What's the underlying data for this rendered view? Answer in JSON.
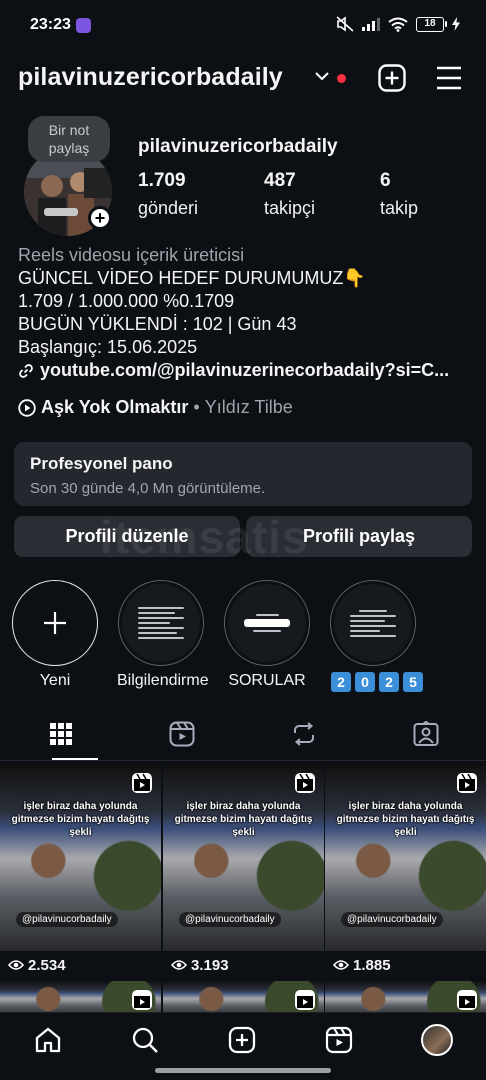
{
  "status_bar": {
    "time": "23:23",
    "battery": "18"
  },
  "header": {
    "username": "pilavinuzericorbadaily"
  },
  "profile": {
    "note": "Bir not paylaş",
    "name": "pilavinuzericorbadaily",
    "stats": [
      {
        "value": "1.709",
        "label": "gönderi"
      },
      {
        "value": "487",
        "label": "takipçi"
      },
      {
        "value": "6",
        "label": "takip"
      }
    ]
  },
  "bio": {
    "category": "Reels videosu içerik üreticisi",
    "lines": [
      "GÜNCEL VİDEO HEDEF DURUMUMUZ👇",
      "1.709 / 1.000.000 %0.1709",
      "BUGÜN YÜKLENDİ : 102 | Gün 43",
      "Başlangıç: 15.06.2025"
    ],
    "link": "youtube.com/@pilavinuzerinecorbadaily?si=C...",
    "music_song": "Aşk Yok Olmaktır",
    "music_sep": "•",
    "music_artist": "Yıldız Tilbe"
  },
  "pro_dashboard": {
    "title": "Profesyonel pano",
    "subtitle": "Son 30 günde 4,0 Mn görüntüleme."
  },
  "buttons": {
    "edit": "Profili düzenle",
    "share": "Profili paylaş"
  },
  "watermark": "itemsatis",
  "highlights": [
    {
      "label": "Yeni"
    },
    {
      "label": "Bilgilendirme"
    },
    {
      "label": "SORULAR"
    },
    {
      "label": "2025",
      "digits": [
        "2",
        "0",
        "2",
        "5"
      ]
    }
  ],
  "tabs": [
    "grid-icon",
    "reels-icon",
    "reposts-icon",
    "tagged-icon"
  ],
  "posts": [
    {
      "caption": "işler biraz daha yolunda gitmezse bizim hayatı dağıtış şekli",
      "handle": "@pilavinucorbadaily",
      "views": "2.534"
    },
    {
      "caption": "işler biraz daha yolunda gitmezse bizim hayatı dağıtış şekli",
      "handle": "@pilavinucorbadaily",
      "views": "3.193"
    },
    {
      "caption": "işler biraz daha yolunda gitmezse bizim hayatı dağıtış şekli",
      "handle": "@pilavinucorbadaily",
      "views": "1.885"
    }
  ],
  "bottom_nav": [
    "home-icon",
    "search-icon",
    "create-icon",
    "reels-icon",
    "profile-avatar"
  ]
}
